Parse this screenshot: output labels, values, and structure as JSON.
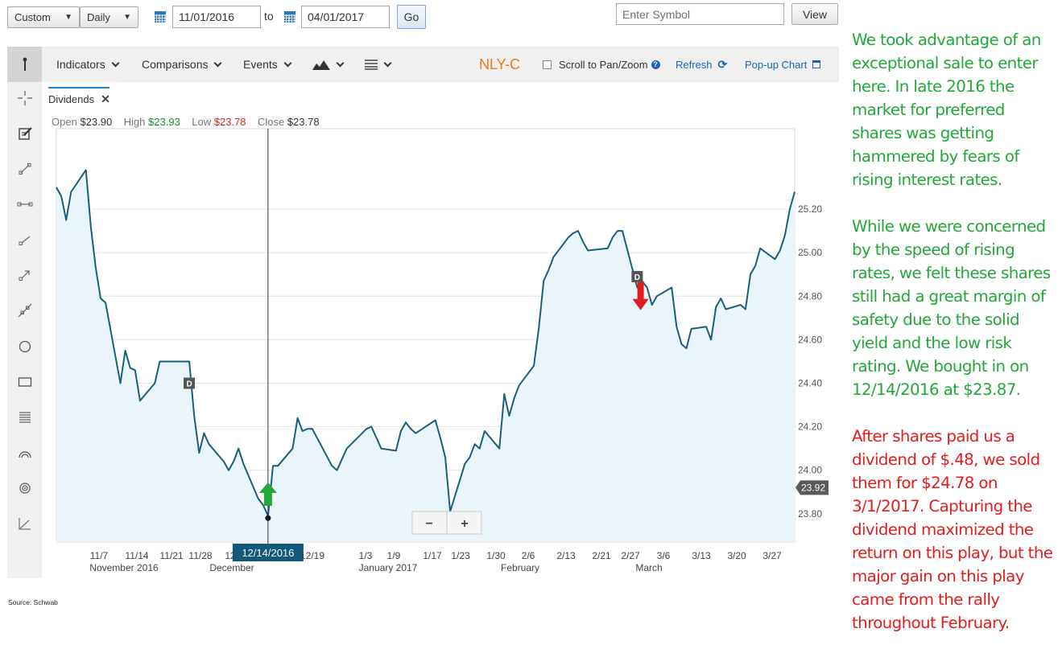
{
  "controls": {
    "range_type": "Custom",
    "frequency": "Daily",
    "start_date": "11/01/2016",
    "to_label": "to",
    "end_date": "04/01/2017",
    "go_label": "Go",
    "symbol_placeholder": "Enter Symbol",
    "view_label": "View"
  },
  "toolbar": {
    "indicators": "Indicators",
    "comparisons": "Comparisons",
    "events": "Events",
    "symbol": "NLY-C",
    "scroll_label": "Scroll to Pan/Zoom",
    "refresh": "Refresh",
    "popup": "Pop-up Chart"
  },
  "legend": {
    "tab_label": "Dividends",
    "open_label": "Open",
    "open_value": "$23.90",
    "high_label": "High",
    "high_value": "$23.93",
    "low_label": "Low",
    "low_value": "$23.78",
    "close_label": "Close",
    "close_value": "$23.78"
  },
  "colors": {
    "line": "#1a5f7a",
    "fill": "#eaf5fb",
    "buy_arrow": "#22a838",
    "sell_arrow": "#e11d1d",
    "commentary_green": "#22a838",
    "commentary_red": "#e11d1d",
    "symbol": "#f07a1a"
  },
  "icons": [
    "calendar-icon",
    "help-icon",
    "refresh-icon",
    "popup-icon",
    "crosshair-icon",
    "note-icon",
    "line-tool-icon",
    "circle-tool-icon",
    "rectangle-tool-icon"
  ],
  "chart_data": {
    "type": "line",
    "title": "",
    "xlabel": "",
    "ylabel": "",
    "ylim": [
      23.67,
      25.57
    ],
    "yticks": [
      23.8,
      24.0,
      24.2,
      24.4,
      24.6,
      24.8,
      25.0,
      25.2
    ],
    "ytick_labels": [
      "23.80",
      "24.00",
      "24.20",
      "24.40",
      "24.60",
      "24.80",
      "25.00",
      "25.20"
    ],
    "x_tick_labels": [
      "11/7",
      "11/14",
      "11/21",
      "11/28",
      "12",
      "12/19",
      "1/3",
      "1/9",
      "1/17",
      "1/23",
      "1/30",
      "2/6",
      "2/13",
      "2/21",
      "2/27",
      "3/6",
      "3/13",
      "3/20",
      "3/27"
    ],
    "month_labels": [
      "November 2016",
      "December",
      "January 2017",
      "February",
      "March"
    ],
    "grid": true,
    "legend": "none",
    "series": [
      {
        "dates": [
          "2016-11-01",
          "2016-11-02",
          "2016-11-03",
          "2016-11-04",
          "2016-11-07",
          "2016-11-08",
          "2016-11-09",
          "2016-11-10",
          "2016-11-11",
          "2016-11-14",
          "2016-11-15",
          "2016-11-16",
          "2016-11-17",
          "2016-11-18",
          "2016-11-21",
          "2016-11-22",
          "2016-11-23",
          "2016-11-25",
          "2016-11-28",
          "2016-11-29",
          "2016-11-30",
          "2016-12-01",
          "2016-12-02",
          "2016-12-05",
          "2016-12-06",
          "2016-12-07",
          "2016-12-08",
          "2016-12-09",
          "2016-12-12",
          "2016-12-13",
          "2016-12-14",
          "2016-12-15",
          "2016-12-16",
          "2016-12-19",
          "2016-12-20",
          "2016-12-21",
          "2016-12-22",
          "2016-12-23",
          "2016-12-27",
          "2016-12-28",
          "2016-12-29",
          "2016-12-30",
          "2017-01-03",
          "2017-01-04",
          "2017-01-05",
          "2017-01-06",
          "2017-01-09",
          "2017-01-10",
          "2017-01-11",
          "2017-01-12",
          "2017-01-13",
          "2017-01-17",
          "2017-01-18",
          "2017-01-19",
          "2017-01-20",
          "2017-01-23",
          "2017-01-24",
          "2017-01-25",
          "2017-01-26",
          "2017-01-27",
          "2017-01-30",
          "2017-01-31",
          "2017-02-01",
          "2017-02-02",
          "2017-02-03",
          "2017-02-06",
          "2017-02-07",
          "2017-02-08",
          "2017-02-09",
          "2017-02-10",
          "2017-02-13",
          "2017-02-14",
          "2017-02-15",
          "2017-02-16",
          "2017-02-17",
          "2017-02-21",
          "2017-02-22",
          "2017-02-23",
          "2017-02-24",
          "2017-02-27",
          "2017-02-28",
          "2017-03-01",
          "2017-03-02",
          "2017-03-03",
          "2017-03-06",
          "2017-03-07",
          "2017-03-08",
          "2017-03-09",
          "2017-03-10",
          "2017-03-13",
          "2017-03-14",
          "2017-03-15",
          "2017-03-16",
          "2017-03-17",
          "2017-03-20",
          "2017-03-21",
          "2017-03-22",
          "2017-03-23",
          "2017-03-24",
          "2017-03-27",
          "2017-03-28",
          "2017-03-29",
          "2017-03-30",
          "2017-03-31"
        ],
        "close": [
          25.3,
          25.26,
          25.15,
          25.28,
          25.38,
          25.12,
          24.93,
          24.79,
          24.77,
          24.4,
          24.55,
          24.47,
          24.46,
          24.32,
          24.4,
          24.5,
          24.5,
          24.5,
          24.5,
          24.25,
          24.08,
          24.17,
          24.12,
          24.04,
          24.0,
          24.04,
          24.1,
          24.03,
          23.87,
          23.84,
          23.79,
          24.02,
          24.02,
          24.1,
          24.24,
          24.18,
          24.19,
          24.19,
          24.02,
          24.0,
          24.05,
          24.1,
          24.19,
          24.2,
          24.15,
          24.1,
          24.09,
          24.18,
          24.22,
          24.19,
          24.17,
          24.23,
          24.15,
          24.06,
          23.81,
          24.03,
          24.06,
          24.12,
          24.1,
          24.18,
          24.1,
          24.35,
          24.25,
          24.33,
          24.39,
          24.48,
          24.65,
          24.87,
          24.92,
          24.98,
          25.07,
          25.09,
          25.1,
          25.05,
          25.01,
          25.02,
          25.07,
          25.1,
          25.1,
          24.84,
          24.87,
          24.84,
          24.76,
          24.8,
          24.84,
          24.66,
          24.58,
          24.56,
          24.65,
          24.66,
          24.6,
          24.75,
          24.79,
          24.74,
          24.76,
          24.74,
          24.9,
          24.94,
          25.02,
          24.97,
          25.01,
          25.08,
          25.2,
          25.28,
          25.4
        ]
      }
    ],
    "dividend_markers": [
      {
        "date": "2016-11-28",
        "value": 24.4,
        "label": "D"
      },
      {
        "date": "2017-02-27",
        "value": 24.89,
        "label": "D"
      }
    ],
    "buy_marker": {
      "date": "2016-12-14",
      "value": 23.87,
      "label": "12/14/2016"
    },
    "sell_marker": {
      "date": "2017-03-01",
      "value": 24.78
    },
    "last_price_label": "23.92",
    "zoom_out_label": "−",
    "zoom_in_label": "+"
  },
  "commentary": {
    "p1": "We took advantage of an exceptional sale to enter here. In late 2016 the market for preferred shares was getting hammered by fears of rising interest rates.",
    "p2": "While we were concerned by the speed of rising rates, we felt these shares still had a great margin of safety due to the solid yield and the low risk rating. We bought in on 12/14/2016 at $23.87.",
    "p3": "After shares paid us a dividend of $.48, we sold them for $24.78 on 3/1/2017. Capturing the dividend maximized the return on this play, but the major gain on this play came from the rally throughout February."
  },
  "source": "Source: Schwab"
}
